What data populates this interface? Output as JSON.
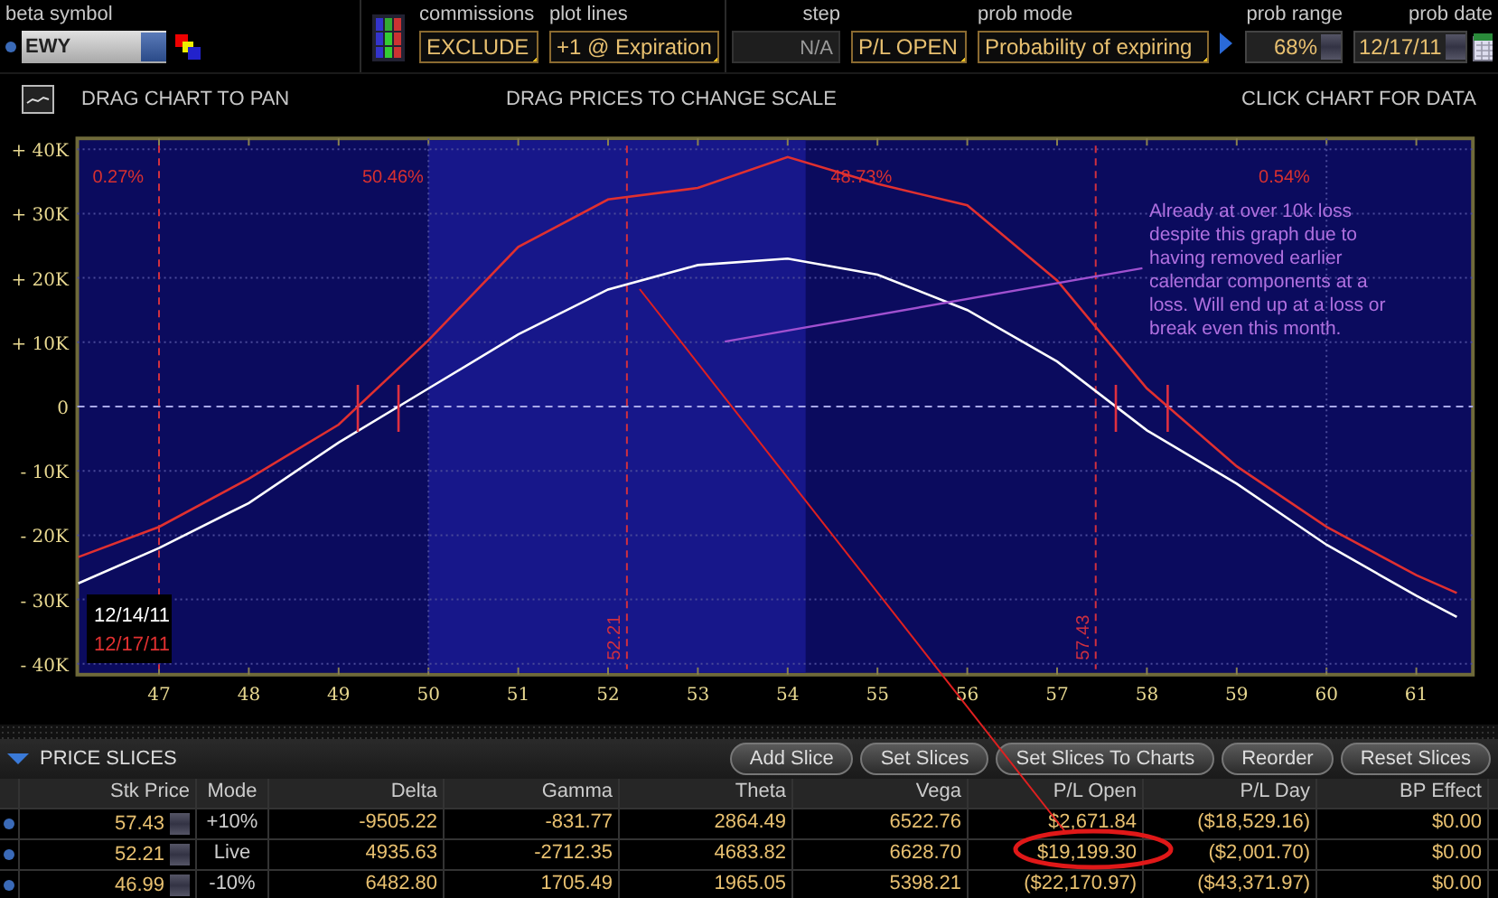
{
  "toolbar": {
    "beta_symbol": {
      "label": "beta symbol",
      "value": "EWY"
    },
    "commissions": {
      "label": "commissions",
      "value": "EXCLUDE"
    },
    "plot_lines": {
      "label": "plot lines",
      "value": "+1 @ Expiration"
    },
    "step": {
      "label": "step",
      "value": "N/A",
      "disabled": true
    },
    "pl_mode": {
      "value": "P/L OPEN"
    },
    "prob_mode": {
      "label": "prob mode",
      "value": "Probability of expiring"
    },
    "prob_range": {
      "label": "prob range",
      "value": "68%"
    },
    "prob_date": {
      "label": "prob date",
      "value": "12/17/11"
    }
  },
  "chart_header": {
    "pan_hint": "DRAG CHART TO PAN",
    "scale_hint": "DRAG PRICES TO CHANGE SCALE",
    "data_hint": "CLICK CHART FOR DATA"
  },
  "chart": {
    "chart_data": {
      "type": "line",
      "x": [
        46.1,
        47,
        48,
        49,
        50,
        51,
        52,
        53,
        54,
        55,
        56,
        57,
        58,
        59,
        60,
        61,
        61.45
      ],
      "series": [
        {
          "name": "12/14/11",
          "color": "#ffffff",
          "values": [
            -27500,
            -22000,
            -15000,
            -5600,
            2800,
            11200,
            18200,
            22000,
            23000,
            20500,
            15000,
            7000,
            -3700,
            -12000,
            -21500,
            -29400,
            -32700
          ]
        },
        {
          "name": "12/17/11",
          "color": "#e03030",
          "values": [
            -23400,
            -18700,
            -11200,
            -2800,
            10300,
            24800,
            32200,
            34000,
            38800,
            34600,
            31300,
            19600,
            2800,
            -9300,
            -18700,
            -26200,
            -29000
          ]
        }
      ],
      "xlim": [
        46.09,
        61.63
      ],
      "ylim": [
        -40000,
        40000
      ],
      "xticks": [
        47,
        48,
        49,
        50,
        51,
        52,
        53,
        54,
        55,
        56,
        57,
        58,
        59,
        60,
        61
      ],
      "yticks": [
        {
          "value": 40000,
          "label": "+ 40K"
        },
        {
          "value": 30000,
          "label": "+ 30K"
        },
        {
          "value": 20000,
          "label": "+ 20K"
        },
        {
          "value": 10000,
          "label": "+ 10K"
        },
        {
          "value": 0,
          "label": "0"
        },
        {
          "value": -10000,
          "label": "- 10K"
        },
        {
          "value": -20000,
          "label": "- 20K"
        },
        {
          "value": -30000,
          "label": "- 30K"
        },
        {
          "value": -40000,
          "label": "- 40K"
        }
      ],
      "grid": true,
      "bands": [
        {
          "axis": "x",
          "from": 50,
          "to": 54.2
        }
      ],
      "ref_lines": [
        {
          "axis": "x",
          "value": 47
        },
        {
          "axis": "x",
          "value": 52.21,
          "label": "52.21"
        },
        {
          "axis": "x",
          "value": 57.43,
          "label": "57.43"
        },
        {
          "axis": "y",
          "value": 0
        }
      ]
    },
    "probabilities": [
      "0.27%",
      "50.46%",
      "48.73%",
      "0.54%"
    ],
    "note": "Already at over 10k loss despite this graph due to having removed earlier calendar components at a loss. Will end up at a loss or break even this month."
  },
  "price_slices": {
    "title": "PRICE SLICES",
    "buttons": [
      "Add Slice",
      "Set Slices",
      "Set Slices To Charts",
      "Reorder",
      "Reset Slices"
    ],
    "columns": [
      "Stk Price",
      "Mode",
      "Delta",
      "Gamma",
      "Theta",
      "Vega",
      "P/L Open",
      "P/L Day",
      "BP Effect"
    ],
    "rows": [
      {
        "stk_price": "57.43",
        "mode": "+10%",
        "delta": "-9505.22",
        "gamma": "-831.77",
        "theta": "2864.49",
        "vega": "6522.76",
        "pl_open": "$2,671.84",
        "pl_day": "($18,529.16)",
        "bp_effect": "$0.00"
      },
      {
        "stk_price": "52.21",
        "mode": "Live",
        "delta": "4935.63",
        "gamma": "-2712.35",
        "theta": "4683.82",
        "vega": "6628.70",
        "pl_open": "$19,199.30",
        "pl_day": "($2,001.70)",
        "bp_effect": "$0.00"
      },
      {
        "stk_price": "46.99",
        "mode": "-10%",
        "delta": "6482.80",
        "gamma": "1705.49",
        "theta": "1965.05",
        "vega": "5398.21",
        "pl_open": "($22,170.97)",
        "pl_day": "($43,371.97)",
        "bp_effect": "$0.00"
      }
    ]
  }
}
